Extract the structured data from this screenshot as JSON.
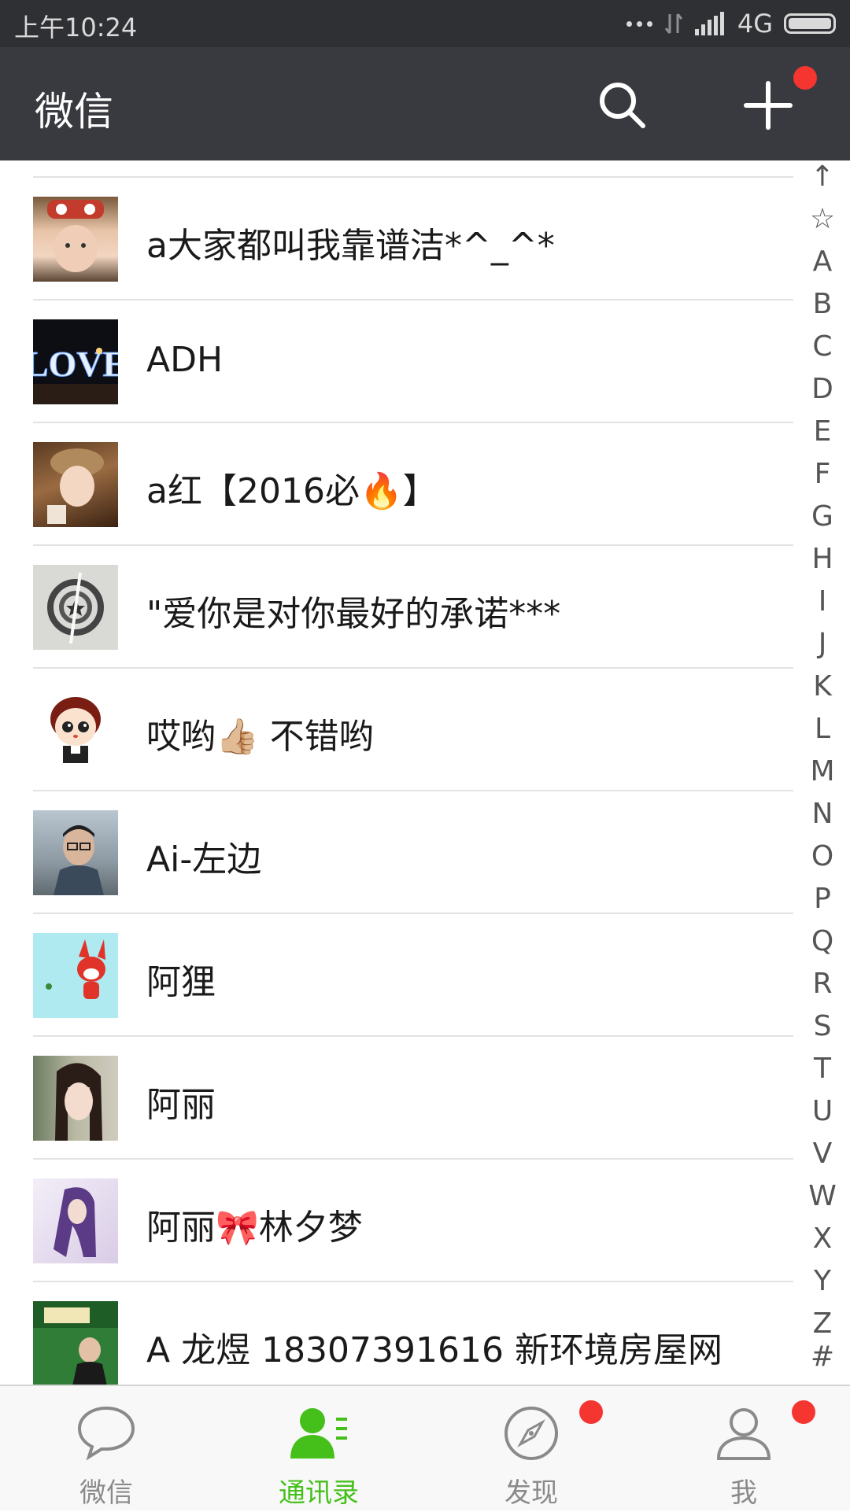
{
  "status_bar": {
    "time": "上午10:24",
    "network": "4G"
  },
  "app_bar": {
    "title": "微信",
    "icons": [
      "search-icon",
      "plus-icon"
    ]
  },
  "contacts": [
    {
      "name": "a大家都叫我靠谱洁*^_^*",
      "avatar": "avatar-photo-girl-headband"
    },
    {
      "name": "ADH",
      "avatar": "avatar-love-neon"
    },
    {
      "name": "a红【2016必🔥】",
      "avatar": "avatar-photo-girl-hat"
    },
    {
      "name": "\"爱你是对你最好的承诺***",
      "avatar": "avatar-shield-logo"
    },
    {
      "name": "哎哟👍🏼 不错哟",
      "avatar": "avatar-cartoon-boy"
    },
    {
      "name": "Ai-左边",
      "avatar": "avatar-photo-man-glasses"
    },
    {
      "name": "阿狸",
      "avatar": "avatar-cartoon-fox"
    },
    {
      "name": "阿丽",
      "avatar": "avatar-photo-girl"
    },
    {
      "name": "阿丽🎀林夕梦",
      "avatar": "avatar-photo-girl-purple"
    },
    {
      "name": "A 龙煜 18307391616 新环境房屋网",
      "avatar": "avatar-photo-realestate"
    }
  ],
  "index_bar": [
    "↑",
    "☆",
    "A",
    "B",
    "C",
    "D",
    "E",
    "F",
    "G",
    "H",
    "I",
    "J",
    "K",
    "L",
    "M",
    "N",
    "O",
    "P",
    "Q",
    "R",
    "S",
    "T",
    "U",
    "V",
    "W",
    "X",
    "Y",
    "Z",
    "#"
  ],
  "tabs": [
    {
      "label": "微信",
      "icon": "chat-bubble-icon",
      "active": false,
      "badge": false
    },
    {
      "label": "通讯录",
      "icon": "contacts-icon",
      "active": true,
      "badge": false
    },
    {
      "label": "发现",
      "icon": "compass-icon",
      "active": false,
      "badge": true
    },
    {
      "label": "我",
      "icon": "person-icon",
      "active": false,
      "badge": true
    }
  ],
  "colors": {
    "app_bar": "#393a3f",
    "status_bar": "#2f3033",
    "accent_green": "#45c01a",
    "badge_red": "#f43530"
  }
}
